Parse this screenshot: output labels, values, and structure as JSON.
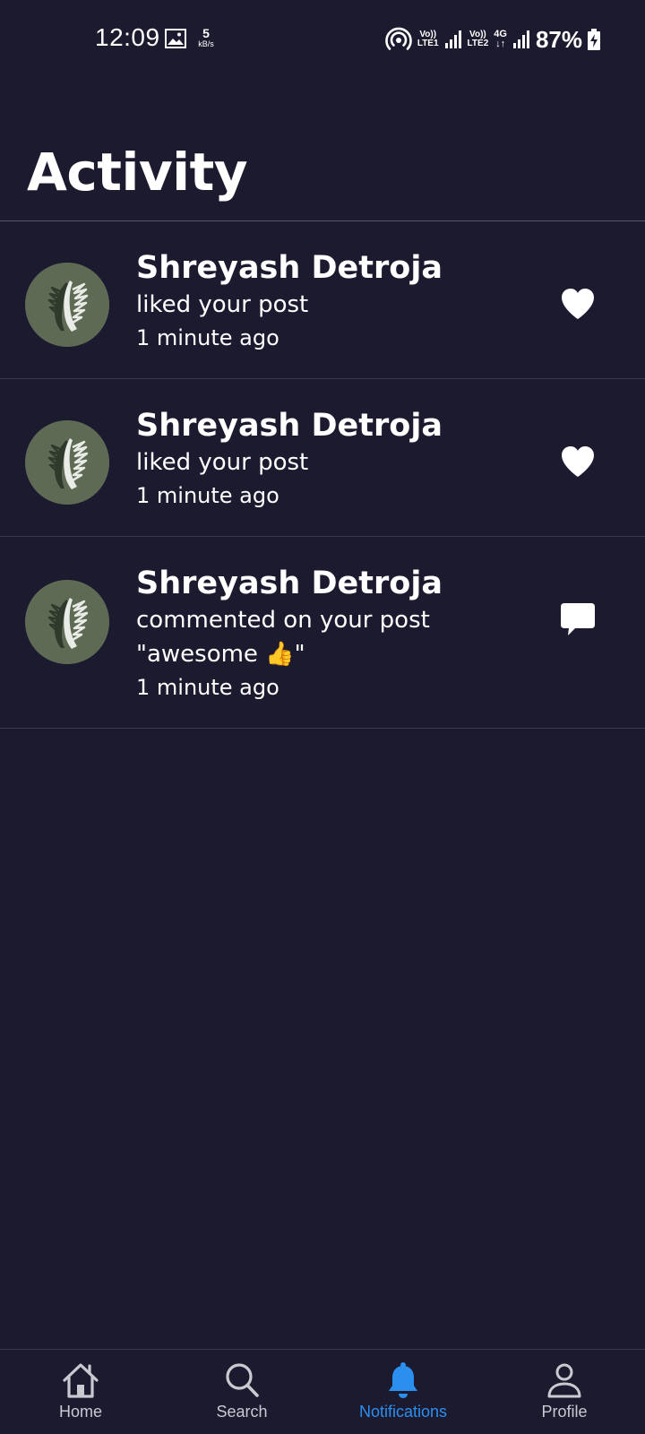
{
  "status_bar": {
    "time": "12:09",
    "net_speed_value": "5",
    "net_speed_unit": "kB/s",
    "sim1_top": "Vo))",
    "sim1_bottom": "LTE1",
    "sim2_top": "Vo))",
    "sim2_bottom": "LTE2",
    "network_type": "4G",
    "network_arrows": "↓↑",
    "battery": "87%"
  },
  "header": {
    "title": "Activity"
  },
  "activities": [
    {
      "name": "Shreyash Detroja",
      "action": "liked your post",
      "time": "1 minute ago",
      "icon": "heart-icon"
    },
    {
      "name": "Shreyash Detroja",
      "action": "liked your post",
      "time": "1 minute ago",
      "icon": "heart-icon"
    },
    {
      "name": "Shreyash Detroja",
      "action": "commented on your post",
      "comment": "\"awesome 👍\"",
      "time": "1 minute ago",
      "icon": "comment-icon"
    }
  ],
  "bottom_nav": {
    "home": "Home",
    "search": "Search",
    "notifications": "Notifications",
    "profile": "Profile",
    "active": "notifications"
  },
  "colors": {
    "background": "#1c1a2f",
    "accent": "#2b8ff0",
    "text": "#ffffff",
    "avatar_bg": "#5e6a54"
  }
}
